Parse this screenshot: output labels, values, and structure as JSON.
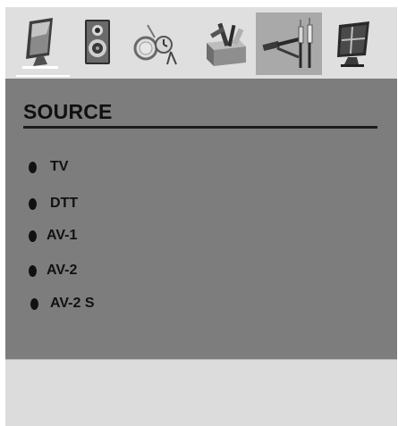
{
  "toolbar": {
    "icons": [
      {
        "name": "picture-icon"
      },
      {
        "name": "sound-icon"
      },
      {
        "name": "timer-icon"
      },
      {
        "name": "setup-icon"
      },
      {
        "name": "source-icon",
        "active": true
      },
      {
        "name": "tv-icon"
      }
    ]
  },
  "menu": {
    "title": "SOURCE",
    "items": [
      {
        "label": "TV"
      },
      {
        "label": "DTT"
      },
      {
        "label": "AV-1"
      },
      {
        "label": "AV-2"
      },
      {
        "label": "AV-2 S"
      }
    ]
  },
  "colors": {
    "panel": "#7d7d7d",
    "toolbar": "#dfdfdf",
    "active_tab": "#a9a9a9",
    "text": "#111111"
  }
}
